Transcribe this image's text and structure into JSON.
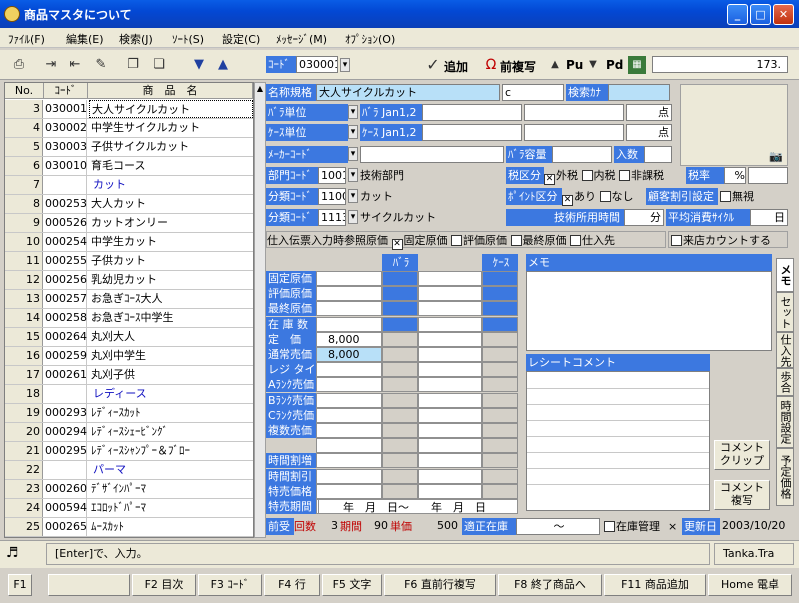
{
  "window": {
    "title": "商品マスタについて",
    "min": "_",
    "max": "□",
    "close": "✕"
  },
  "menu": [
    "ﾌｧｲﾙ(F)",
    "編集(E)",
    "検索(J)",
    "ｿｰﾄ(S)",
    "設定(C)",
    "ﾒｯｾｰｼﾞ(M)",
    "ｵﾌﾟｼｮﾝ(O)"
  ],
  "toolbar": {
    "code_label": "ｺｰﾄﾞ",
    "code_value": "030001",
    "add": "追加",
    "copy_prev": "前複写",
    "pu": "Pu",
    "pd": "Pd",
    "amount": "173."
  },
  "list": {
    "headers": [
      "No.",
      "ｺｰﾄﾞ",
      "商　品　名"
    ],
    "rows": [
      {
        "no": "3",
        "code": "030001",
        "name": "大人サイクルカット",
        "sel": true
      },
      {
        "no": "4",
        "code": "030002",
        "name": "中学生サイクルカット"
      },
      {
        "no": "5",
        "code": "030003",
        "name": "子供サイクルカット"
      },
      {
        "no": "6",
        "code": "030010",
        "name": "育毛コース"
      },
      {
        "no": "7",
        "code": "",
        "name": "カット",
        "cat": true
      },
      {
        "no": "8",
        "code": "000253",
        "name": "大人カット"
      },
      {
        "no": "9",
        "code": "000526",
        "name": "カットオンリー"
      },
      {
        "no": "10",
        "code": "000254",
        "name": "中学生カット"
      },
      {
        "no": "11",
        "code": "000255",
        "name": "子供カット"
      },
      {
        "no": "12",
        "code": "000256",
        "name": "乳幼児カット"
      },
      {
        "no": "13",
        "code": "000257",
        "name": "お急ぎｺｰｽ大人"
      },
      {
        "no": "14",
        "code": "000258",
        "name": "お急ぎｺｰｽ中学生"
      },
      {
        "no": "15",
        "code": "000264",
        "name": "丸刈大人"
      },
      {
        "no": "16",
        "code": "000259",
        "name": "丸刈中学生"
      },
      {
        "no": "17",
        "code": "000261",
        "name": "丸刈子供"
      },
      {
        "no": "18",
        "code": "",
        "name": "レディース",
        "cat": true
      },
      {
        "no": "19",
        "code": "000293",
        "name": "ﾚﾃﾞｨｰｽｶｯﾄ"
      },
      {
        "no": "20",
        "code": "000294",
        "name": "ﾚﾃﾞｨｰｽｼｪｰﾋﾞﾝｸﾞ"
      },
      {
        "no": "21",
        "code": "000295",
        "name": "ﾚﾃﾞｨｰｽｼｬﾝﾌﾟｰ＆ﾌﾞﾛｰ"
      },
      {
        "no": "22",
        "code": "",
        "name": "パーマ",
        "cat": true
      },
      {
        "no": "23",
        "code": "000260",
        "name": "ﾃﾞｻﾞｲﾝﾊﾟｰﾏ"
      },
      {
        "no": "24",
        "code": "000594",
        "name": "ｴｺﾛｯﾄﾞﾊﾟｰﾏ"
      },
      {
        "no": "25",
        "code": "000265",
        "name": "ﾑｰｽｶｯﾄ"
      }
    ]
  },
  "form": {
    "name_label": "名称規格",
    "name_value": "大人サイクルカット",
    "name_c": "c",
    "search_label": "検索ｶﾅ",
    "bara_unit_label": "ﾊﾞﾗ単位",
    "bara_jan_label": "ﾊﾞﾗ Jan1,2",
    "ten1": "点",
    "case_unit_label": "ｹｰｽ単位",
    "case_jan_label": "ｹｰｽ Jan1,2",
    "ten2": "点",
    "maker_label": "ﾒｰｶｰｺｰﾄﾞ",
    "bara_cap_label": "ﾊﾞﾗ容量",
    "irisu_label": "入数",
    "dept_label": "部門ｺｰﾄﾞ",
    "dept_code": "1001",
    "dept_name": "技術部門",
    "tax_label": "税区分",
    "tax_opts": [
      "外税",
      "内税",
      "非課税"
    ],
    "tax_rate_label": "税率",
    "pct": "%",
    "cls_label": "分類ｺｰﾄﾞ",
    "cls_code": "1100",
    "cls_name": "カット",
    "point_label": "ﾎﾟｲﾝﾄ区分",
    "point_opts": [
      "あり",
      "なし"
    ],
    "cust_disc_label": "顧客割引設定",
    "mushi": "無視",
    "cls2_label": "分類ｺｰﾄﾞ",
    "cls2_code": "1113",
    "cls2_name": "サイクルカット",
    "tech_time_label": "技術所用時間",
    "fun": "分",
    "avg_cycle_label": "平均消費ｻｲｸﾙ",
    "day": "日",
    "ref_label": "仕入伝票入力時参照原価",
    "ref_opts": [
      "固定原価",
      "評価原価",
      "最終原価",
      "仕入先"
    ],
    "visit_count": "来店カウントする"
  },
  "price": {
    "col_bara": "ﾊﾞﾗ",
    "col_case": "ｹｰｽ",
    "rows": [
      "固定原価",
      "評価原価",
      "最終原価",
      "在 庫 数",
      "定　価",
      "通常売価",
      "レジ タイム",
      "Aﾗﾝｸ売価",
      "Bﾗﾝｸ売価",
      "Cﾗﾝｸ売価",
      "複数売価",
      "",
      "時間割増",
      "時間割引",
      "特売価格",
      "特売期間"
    ],
    "teika": "8,000",
    "tsujo": "8,000",
    "period_text": "年　月　日～　　年　月　日"
  },
  "memo": {
    "title": "メモ",
    "receipt_title": "レシートコメント",
    "clip_btn": "コメント\nクリップ",
    "copy_btn": "コメント\n複写"
  },
  "tabs": [
    "メモ",
    "セット",
    "仕入先",
    "歩合",
    "時間設定",
    "予定価格"
  ],
  "bottom": {
    "prev_label": "前受",
    "times_label": "回数",
    "times": "3",
    "period_label": "期間",
    "period": "90",
    "unit_label": "単価",
    "unit": "500",
    "stock_label": "適正在庫",
    "tilde": "～",
    "stock_mgmt": "在庫管理",
    "x": "×",
    "updated_label": "更新日",
    "updated": "2003/10/20"
  },
  "status": {
    "text": "[Enter]で、入力。",
    "user": "Tanka.Tra"
  },
  "fkeys": [
    "F2 目次",
    "F3 ｺｰﾄﾞ",
    "F4 行",
    "F5 文字",
    "F6 直前行複写",
    "F8 終了商品へ",
    "F11 商品追加",
    "Home 電卓"
  ]
}
